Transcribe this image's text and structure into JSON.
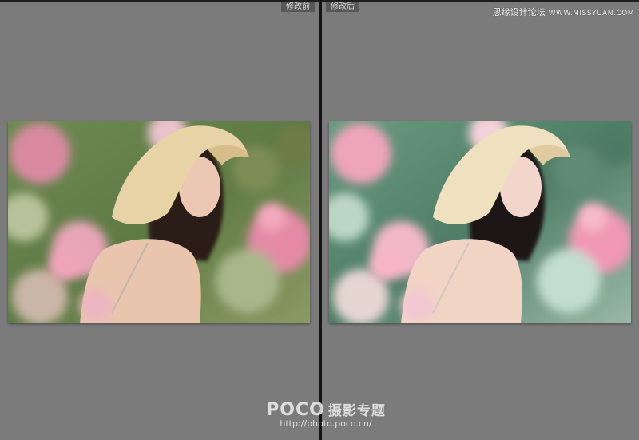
{
  "compare": {
    "before_label": "修改前",
    "after_label": "修改后"
  },
  "site_mark": {
    "text": "思缘设计论坛",
    "url": "WWW.MISSYUAN.COM"
  },
  "watermark": {
    "brand": "POCO",
    "brand_cn": "摄影专题",
    "url": "http://photo.poco.cn/"
  },
  "colors": {
    "background": "#7b7b7b",
    "divider": "#141414",
    "label_bg": "#575757"
  }
}
